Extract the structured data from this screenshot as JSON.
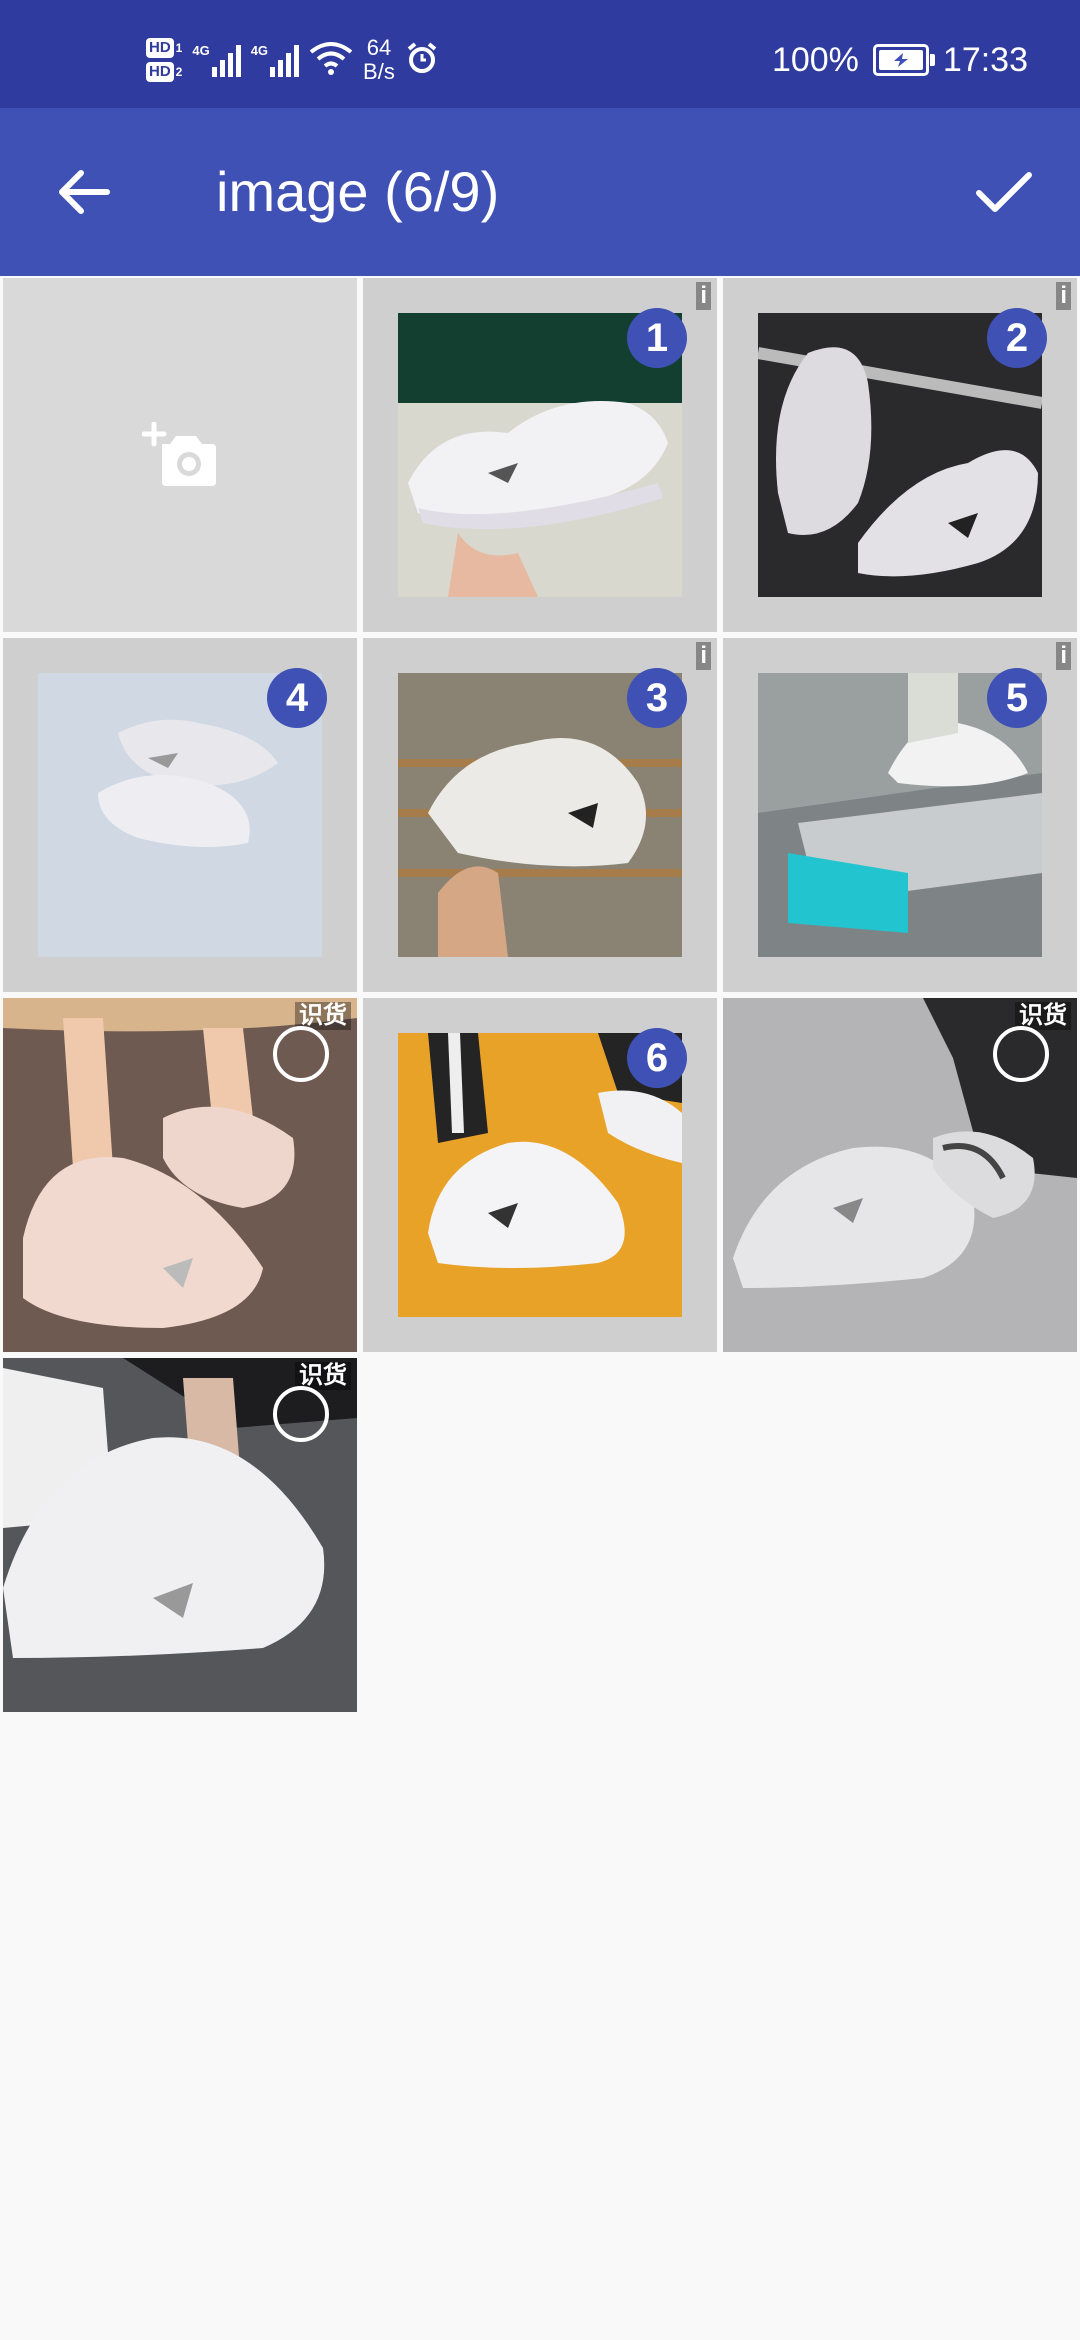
{
  "status_bar": {
    "sim1": "HD",
    "sim1_index": "1",
    "sim2": "HD",
    "sim2_index": "2",
    "net1": "4G",
    "net2": "4G",
    "speed_value": "64",
    "speed_unit": "B/s",
    "battery": "100%",
    "time": "17:33"
  },
  "app_bar": {
    "title": "image (6/9)",
    "back_icon": "arrow-back-icon",
    "done_icon": "check-icon"
  },
  "grid": {
    "camera_icon": "add-camera-icon",
    "items": [
      {
        "selected": true,
        "order": "1",
        "tag": "i"
      },
      {
        "selected": true,
        "order": "2",
        "tag": "i"
      },
      {
        "selected": true,
        "order": "4",
        "tag": ""
      },
      {
        "selected": true,
        "order": "3",
        "tag": "i"
      },
      {
        "selected": true,
        "order": "5",
        "tag": "i"
      },
      {
        "selected": false,
        "order": "",
        "tag": "识货"
      },
      {
        "selected": true,
        "order": "6",
        "tag": ""
      },
      {
        "selected": false,
        "order": "",
        "tag": "识货"
      },
      {
        "selected": false,
        "order": "",
        "tag": "识货"
      }
    ]
  },
  "colors": {
    "status_bar": "#2f3b9e",
    "app_bar": "#3f51b5",
    "badge": "#3f51b5",
    "background": "#f9f9f9"
  }
}
